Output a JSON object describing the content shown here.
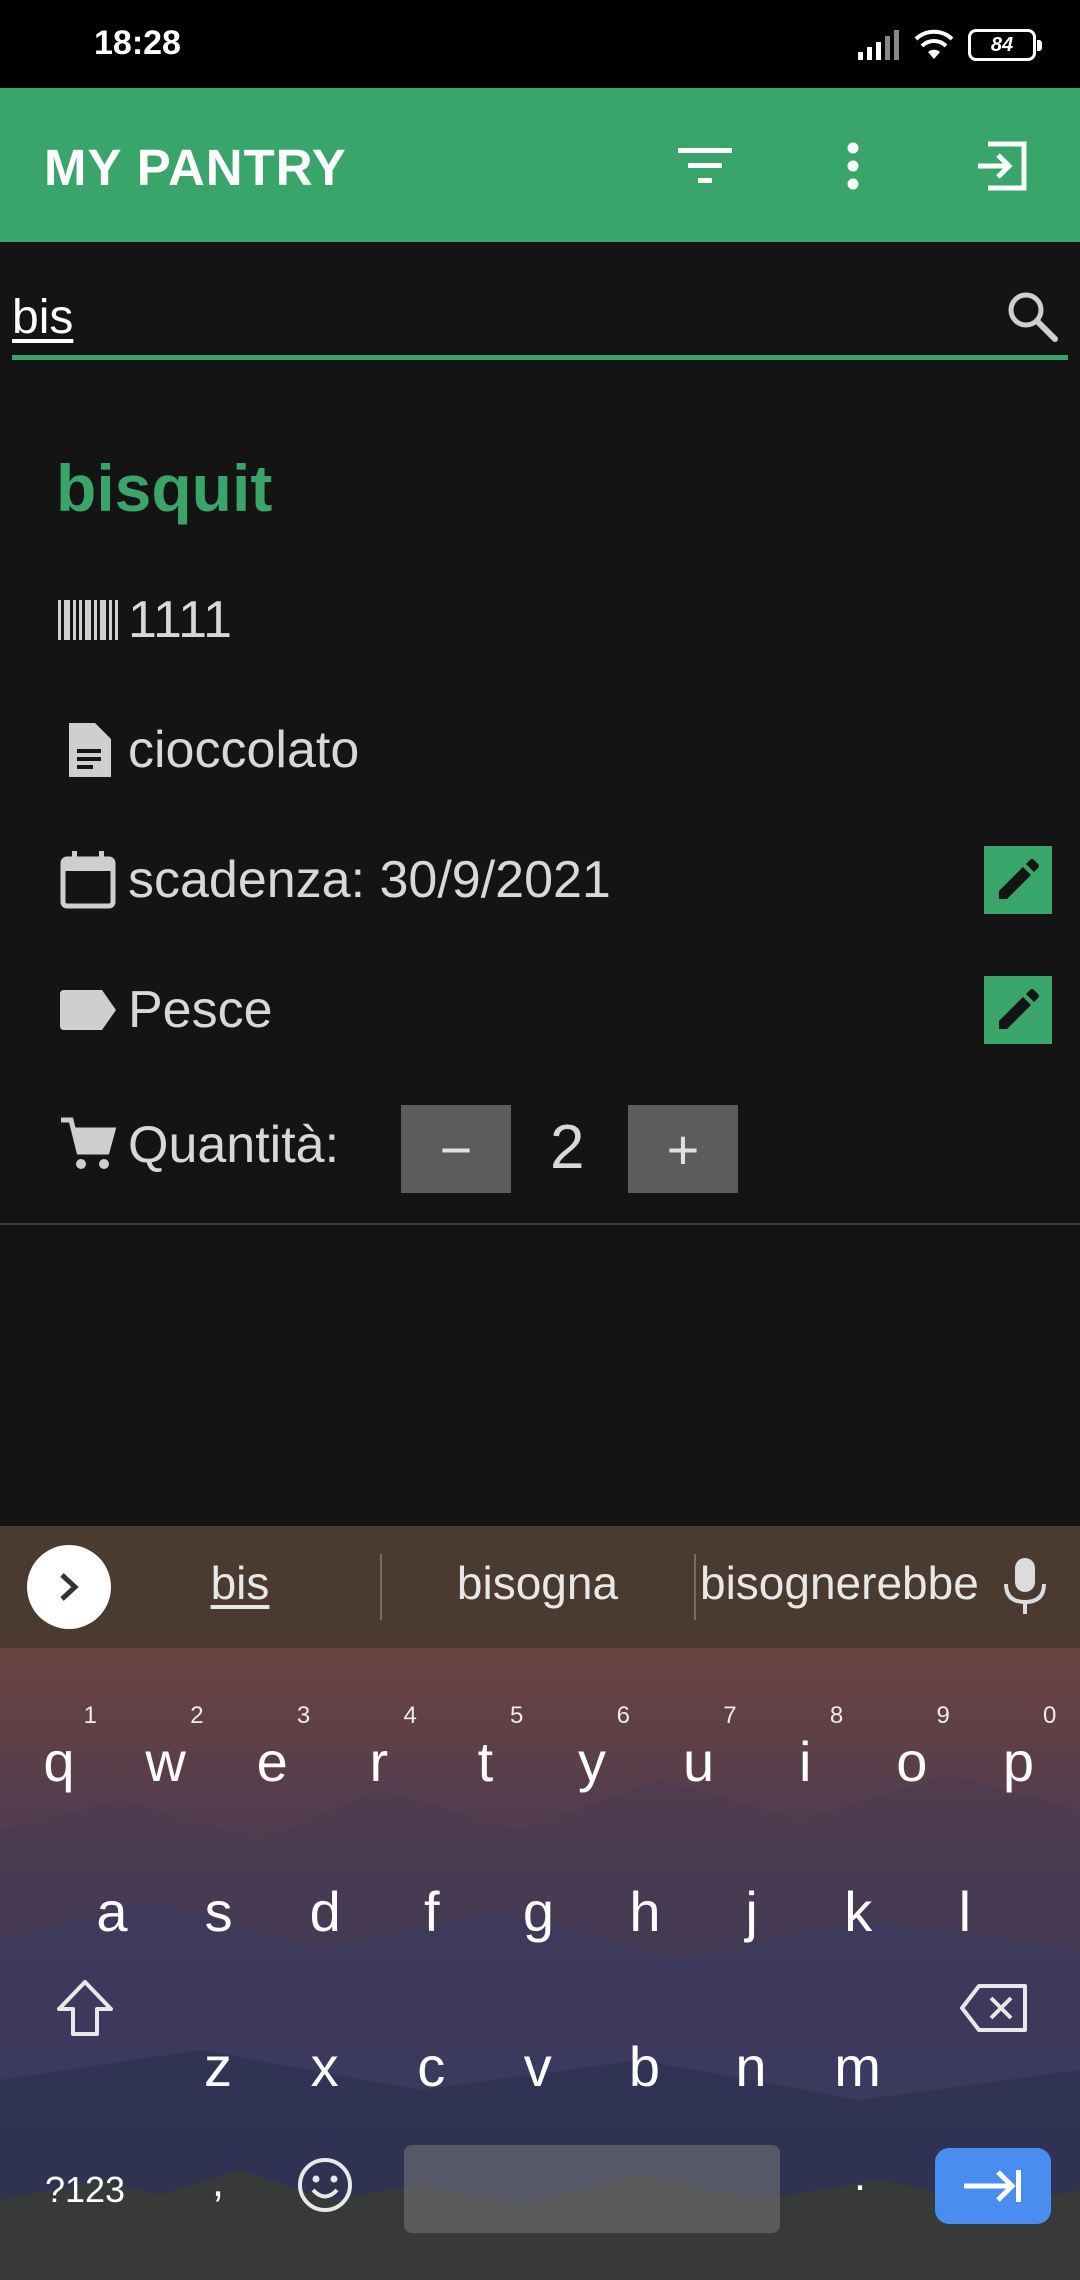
{
  "status_bar": {
    "time": "18:28",
    "battery": "84"
  },
  "app_bar": {
    "title": "MY PANTRY",
    "icons": [
      "filter-icon",
      "more-vert-icon",
      "logout-icon"
    ]
  },
  "search": {
    "value": "bis"
  },
  "product": {
    "name": "bisquit",
    "barcode": "1111",
    "description": "cioccolato",
    "expiry": "scadenza: 30/9/2021",
    "category": "Pesce",
    "quantity_label": "Quantità:",
    "quantity": "2",
    "minus_label": "−",
    "plus_label": "+"
  },
  "keyboard": {
    "suggestions": [
      "bis",
      "bisogna",
      "bisognerebbe"
    ],
    "row1": [
      {
        "k": "q",
        "n": "1"
      },
      {
        "k": "w",
        "n": "2"
      },
      {
        "k": "e",
        "n": "3"
      },
      {
        "k": "r",
        "n": "4"
      },
      {
        "k": "t",
        "n": "5"
      },
      {
        "k": "y",
        "n": "6"
      },
      {
        "k": "u",
        "n": "7"
      },
      {
        "k": "i",
        "n": "8"
      },
      {
        "k": "o",
        "n": "9"
      },
      {
        "k": "p",
        "n": "0"
      }
    ],
    "row2": [
      "a",
      "s",
      "d",
      "f",
      "g",
      "h",
      "j",
      "k",
      "l"
    ],
    "row3": [
      "z",
      "x",
      "c",
      "v",
      "b",
      "n",
      "m"
    ],
    "symbols_label": "?123",
    "comma": ",",
    "period": "."
  },
  "colors": {
    "accent": "#3aa56b",
    "background": "#141414",
    "enter_key": "#4a8df0"
  }
}
